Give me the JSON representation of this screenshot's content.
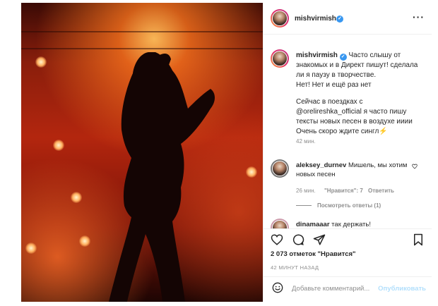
{
  "post": {
    "username": "mishvirmish",
    "more_icon": "more-horizontal-icon"
  },
  "caption": {
    "username": "mishvirmish",
    "line1": "Часто слышу от знакомых и в Директ пишут! сделала ли я паузу в творчестве.",
    "line2": "Нет! Нет и ещё раз нет",
    "line3": "Сейчас в поездках с @orelireshka_official я часто пишу тексты новых песен в воздухе ииии Очень скоро ждите сингл⚡",
    "time": "42 мин."
  },
  "comments": [
    {
      "username": "aleksey_durnev",
      "text": "Мишель, мы хотим новых песен",
      "time": "26 мин.",
      "likes": "\"Нравится\": 7",
      "reply": "Ответить",
      "view_replies": "Посмотреть ответы (1)"
    },
    {
      "username": "dinamaaar",
      "text": "так держать!"
    }
  ],
  "actions": {
    "likes_count": "2 073 отметок \"Нравится\"",
    "time_ago": "42 МИНУТ НАЗАД"
  },
  "composer": {
    "placeholder": "Добавьте комментарий...",
    "publish": "Опубликовать"
  },
  "colors": {
    "verified": "#3897f0",
    "publish_disabled": "#b2dffc",
    "meta_gray": "#8e8e8e"
  }
}
